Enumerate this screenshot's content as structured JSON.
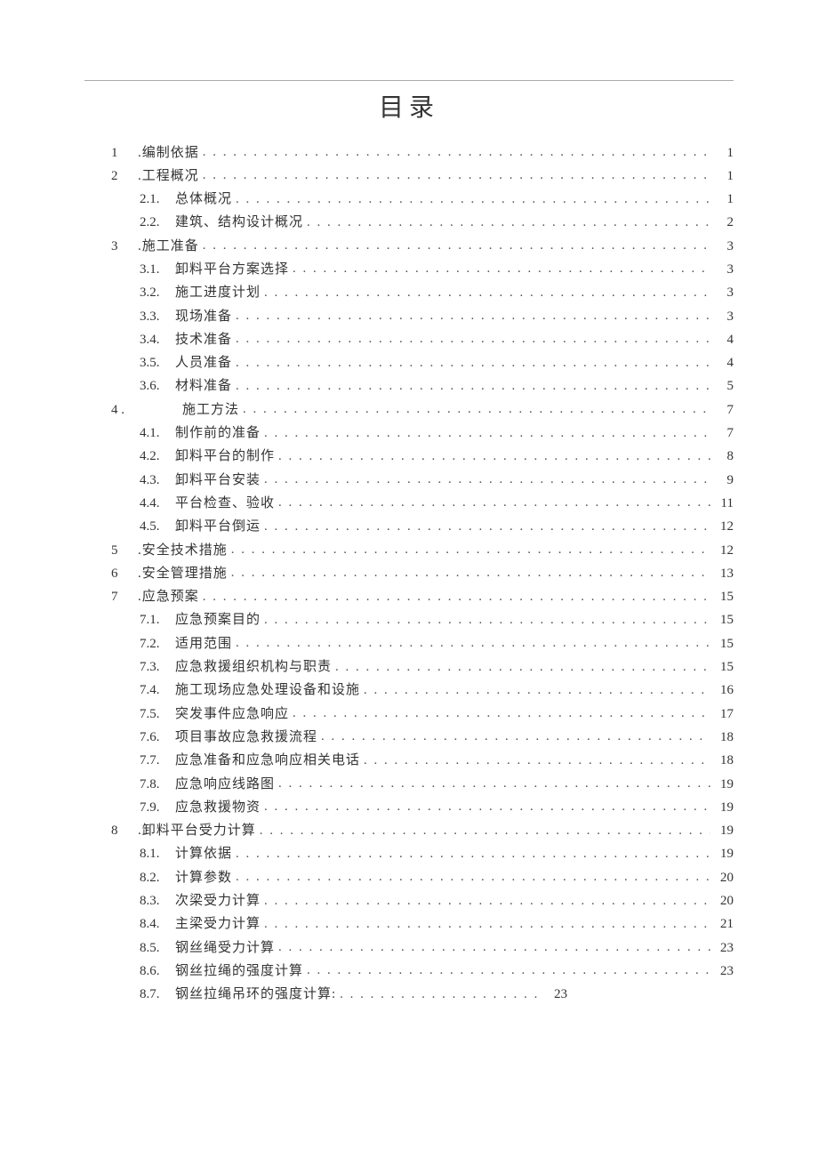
{
  "title": "目录",
  "toc": [
    {
      "level": 1,
      "num": "1",
      "label": ".编制依据",
      "page": "1"
    },
    {
      "level": 1,
      "num": "2",
      "label": ".工程概况",
      "page": "1"
    },
    {
      "level": 2,
      "num": "2.1.",
      "label": "总体概况",
      "page": "1"
    },
    {
      "level": 2,
      "num": "2.2.",
      "label": "建筑、结构设计概况",
      "page": "2"
    },
    {
      "level": 1,
      "num": "3",
      "label": ".施工准备",
      "page": "3"
    },
    {
      "level": 2,
      "num": "3.1.",
      "label": "卸料平台方案选择",
      "page": "3"
    },
    {
      "level": 2,
      "num": "3.2.",
      "label": "施工进度计划",
      "page": "3"
    },
    {
      "level": 2,
      "num": "3.3.",
      "label": "现场准备",
      "page": "3"
    },
    {
      "level": 2,
      "num": "3.4.",
      "label": "技术准备",
      "page": "4"
    },
    {
      "level": 2,
      "num": "3.5.",
      "label": "人员准备",
      "page": "4"
    },
    {
      "level": 2,
      "num": "3.6.",
      "label": "材料准备",
      "page": "5"
    },
    {
      "level": 1,
      "num": "4",
      "label": "施工方法",
      "page": "7",
      "extraIndent": true,
      "numSuffix": "  ."
    },
    {
      "level": 2,
      "num": "4.1.",
      "label": "制作前的准备",
      "page": "7"
    },
    {
      "level": 2,
      "num": "4.2.",
      "label": "卸料平台的制作",
      "page": "8"
    },
    {
      "level": 2,
      "num": "4.3.",
      "label": "卸料平台安装",
      "page": "9"
    },
    {
      "level": 2,
      "num": "4.4.",
      "label": "平台检查、验收",
      "page": "11"
    },
    {
      "level": 2,
      "num": "4.5.",
      "label": "卸料平台倒运",
      "page": "12"
    },
    {
      "level": 1,
      "num": "5",
      "label": ".安全技术措施",
      "page": "12"
    },
    {
      "level": 1,
      "num": "6",
      "label": ".安全管理措施",
      "page": "13"
    },
    {
      "level": 1,
      "num": "7",
      "label": ".应急预案",
      "page": "15"
    },
    {
      "level": 2,
      "num": "7.1.",
      "label": "应急预案目的",
      "page": "15"
    },
    {
      "level": 2,
      "num": "7.2.",
      "label": "适用范围",
      "page": "15"
    },
    {
      "level": 2,
      "num": "7.3.",
      "label": "应急救援组织机构与职责",
      "page": "15"
    },
    {
      "level": 2,
      "num": "7.4.",
      "label": "施工现场应急处理设备和设施",
      "page": "16"
    },
    {
      "level": 2,
      "num": "7.5.",
      "label": "突发事件应急响应",
      "page": "17"
    },
    {
      "level": 2,
      "num": "7.6.",
      "label": "项目事故应急救援流程",
      "page": "18"
    },
    {
      "level": 2,
      "num": "7.7.",
      "label": "应急准备和应急响应相关电话",
      "page": "18"
    },
    {
      "level": 2,
      "num": "7.8.",
      "label": "应急响应线路图",
      "page": "19"
    },
    {
      "level": 2,
      "num": "7.9.",
      "label": "应急救援物资",
      "page": "19"
    },
    {
      "level": 1,
      "num": "8",
      "label": ".卸料平台受力计算",
      "page": "19"
    },
    {
      "level": 2,
      "num": "8.1.",
      "label": "计算依据",
      "page": "19"
    },
    {
      "level": 2,
      "num": "8.2.",
      "label": "计算参数",
      "page": "20"
    },
    {
      "level": 2,
      "num": "8.3.",
      "label": "次梁受力计算",
      "page": "20"
    },
    {
      "level": 2,
      "num": "8.4.",
      "label": "主梁受力计算",
      "page": "21"
    },
    {
      "level": 2,
      "num": "8.5.",
      "label": "钢丝绳受力计算",
      "page": "23"
    },
    {
      "level": 2,
      "num": "8.6.",
      "label": "钢丝拉绳的强度计算",
      "page": "23"
    },
    {
      "level": 2,
      "num": "8.7.",
      "label": "钢丝拉绳吊环的强度计算:",
      "page": "23",
      "short": true
    }
  ]
}
